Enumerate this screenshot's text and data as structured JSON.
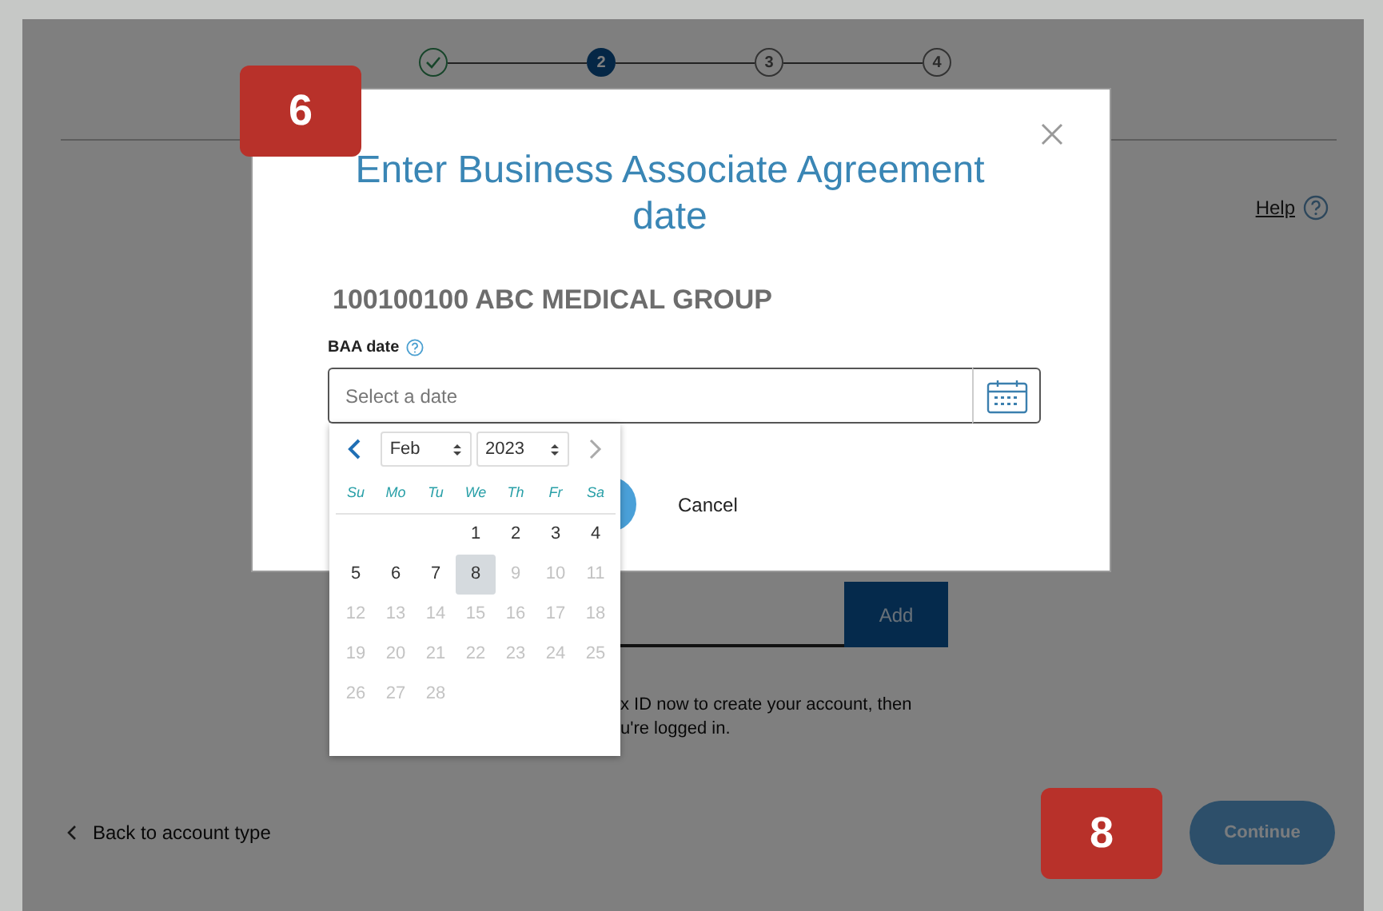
{
  "stepper": {
    "steps": [
      {
        "done": true,
        "selected": false
      },
      {
        "label": "2",
        "done": false,
        "selected": true
      },
      {
        "label": "3",
        "done": false,
        "selected": false
      },
      {
        "label": "4",
        "done": false,
        "selected": false
      }
    ]
  },
  "help_link": "Help",
  "add_button": "Add",
  "info_text": [
    "x ID now to create your account, then",
    "u're logged in."
  ],
  "back_link": "Back to account type",
  "continue_button": "Continue",
  "modal": {
    "title": "Enter Business Associate Agreement date",
    "organization": "100100100  ABC MEDICAL GROUP",
    "field_label": "BAA date",
    "date_field": {
      "placeholder": "Select a date"
    },
    "cancel_button": "Cancel"
  },
  "datepicker": {
    "month": "Feb",
    "year": "2023",
    "weekdays": [
      "Su",
      "Mo",
      "Tu",
      "We",
      "Th",
      "Fr",
      "Sa"
    ],
    "days": [
      {
        "label": "1",
        "disabled": false,
        "selected": false
      },
      {
        "label": "2",
        "disabled": false,
        "selected": false
      },
      {
        "label": "3",
        "disabled": false,
        "selected": false
      },
      {
        "label": "4",
        "disabled": false,
        "selected": false
      },
      {
        "label": "5",
        "disabled": false,
        "selected": false
      },
      {
        "label": "6",
        "disabled": false,
        "selected": false
      },
      {
        "label": "7",
        "disabled": false,
        "selected": false
      },
      {
        "label": "8",
        "disabled": false,
        "selected": true
      },
      {
        "label": "9",
        "disabled": true,
        "selected": false
      },
      {
        "label": "10",
        "disabled": true,
        "selected": false
      },
      {
        "label": "11",
        "disabled": true,
        "selected": false
      },
      {
        "label": "12",
        "disabled": true,
        "selected": false
      },
      {
        "label": "13",
        "disabled": true,
        "selected": false
      },
      {
        "label": "14",
        "disabled": true,
        "selected": false
      },
      {
        "label": "15",
        "disabled": true,
        "selected": false
      },
      {
        "label": "16",
        "disabled": true,
        "selected": false
      },
      {
        "label": "17",
        "disabled": true,
        "selected": false
      },
      {
        "label": "18",
        "disabled": true,
        "selected": false
      },
      {
        "label": "19",
        "disabled": true,
        "selected": false
      },
      {
        "label": "20",
        "disabled": true,
        "selected": false
      },
      {
        "label": "21",
        "disabled": true,
        "selected": false
      },
      {
        "label": "22",
        "disabled": true,
        "selected": false
      },
      {
        "label": "23",
        "disabled": true,
        "selected": false
      },
      {
        "label": "24",
        "disabled": true,
        "selected": false
      },
      {
        "label": "25",
        "disabled": true,
        "selected": false
      },
      {
        "label": "26",
        "disabled": true,
        "selected": false
      },
      {
        "label": "27",
        "disabled": true,
        "selected": false
      },
      {
        "label": "28",
        "disabled": true,
        "selected": false
      }
    ]
  },
  "annotations": [
    {
      "label": "6"
    },
    {
      "label": "8"
    }
  ]
}
